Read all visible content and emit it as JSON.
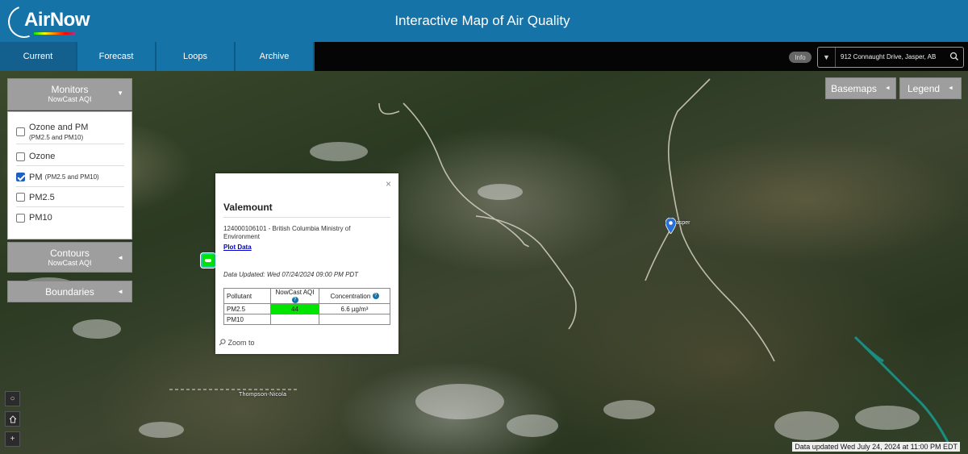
{
  "header": {
    "logo_text": "AirNow",
    "title": "Interactive Map of Air Quality"
  },
  "nav": {
    "tabs": [
      "Current",
      "Forecast",
      "Loops",
      "Archive"
    ],
    "info_label": "Info",
    "search_value": "912 Connaught Drive, Jasper, AB"
  },
  "monitors": {
    "title": "Monitors",
    "subtitle": "NowCast AQI",
    "options": [
      {
        "label": "Ozone and PM",
        "sub": "(PM2.5 and PM10)",
        "checked": false
      },
      {
        "label": "Ozone",
        "sub": "",
        "checked": false
      },
      {
        "label": "PM",
        "sub": "(PM2.5 and PM10)",
        "checked": true
      },
      {
        "label": "PM2.5",
        "sub": "",
        "checked": false
      },
      {
        "label": "PM10",
        "sub": "",
        "checked": false
      }
    ]
  },
  "contours": {
    "title": "Contours",
    "subtitle": "NowCast AQI"
  },
  "boundaries": {
    "title": "Boundaries"
  },
  "map_buttons": {
    "basemaps": "Basemaps",
    "legend": "Legend"
  },
  "popup": {
    "close": "×",
    "title": "Valemount",
    "site": "124000106101 - British Columbia Ministry of Environment",
    "plot_link": "Plot Data",
    "updated": "Data Updated: Wed 07/24/2024 09:00 PM PDT",
    "table": {
      "headers": [
        "Pollutant",
        "NowCast AQI",
        "Concentration"
      ],
      "rows": [
        {
          "pollutant": "PM2.5",
          "aqi": "44",
          "concentration": "6.6 µg/m³",
          "aqi_color": "#00e400"
        },
        {
          "pollutant": "PM10",
          "aqi": "",
          "concentration": "",
          "aqi_color": ""
        }
      ]
    },
    "zoom": "Zoom to"
  },
  "map": {
    "city_label": "asper",
    "region_label": "Thompson-Nicola"
  },
  "footer": {
    "timestamp": "Data updated Wed July 24, 2024 at 11:00 PM EDT"
  },
  "colors": {
    "header": "#1673a8",
    "good_aqi": "#00e400"
  }
}
